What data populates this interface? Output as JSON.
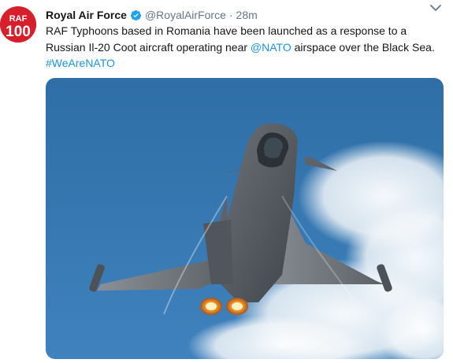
{
  "tweet": {
    "avatar_text_top": "RAF",
    "avatar_text_bottom": "100",
    "author_name": "Royal Air Force",
    "author_handle": "@RoyalAirForce",
    "separator": "·",
    "timestamp": "28m",
    "text_part1": "RAF Typhoons based in Romania have been launched as a response to a Russian Il-20 Coot aircraft operating near ",
    "mention": "@NATO",
    "text_part2": " airspace over the Black Sea.",
    "hashtag": "#WeAreNATO",
    "icons": {
      "verified": "verified-badge-icon",
      "menu": "chevron-down-icon"
    },
    "colors": {
      "link": "#1b95e0",
      "verified": "#1da1f2",
      "avatar_bg": "#d71f2b",
      "muted": "#657786"
    }
  }
}
